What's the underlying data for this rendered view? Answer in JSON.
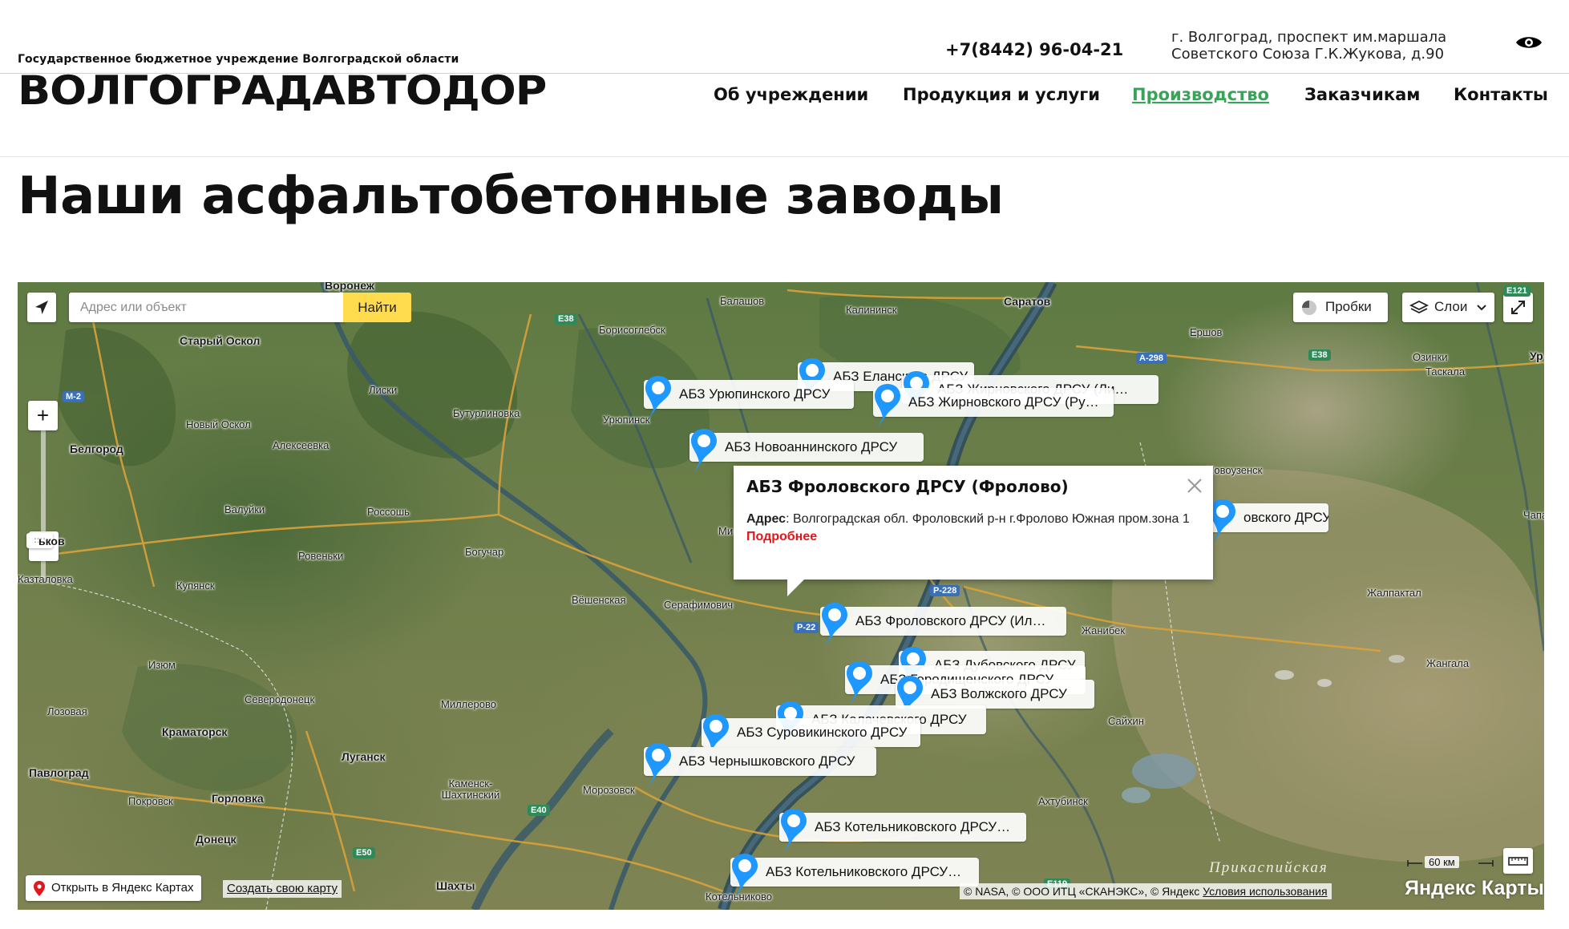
{
  "header": {
    "org_line": "Государственное бюджетное учреждение Волгоградской области",
    "brand": "ВОЛГОГРАДАВТОДОР",
    "phone": "+7(8442) 96-04-21",
    "address_line1": "г. Волгоград, проспект им.маршала",
    "address_line2": "Советского Союза Г.К.Жукова, д.90",
    "nav": [
      {
        "label": "Об учреждении"
      },
      {
        "label": "Продукция и услуги"
      },
      {
        "label": "Производство",
        "active": true
      },
      {
        "label": "Заказчикам"
      },
      {
        "label": "Контакты"
      }
    ],
    "accent_color": "#3aa35a"
  },
  "page": {
    "title": "Наши асфальтобетонные заводы"
  },
  "map": {
    "search": {
      "placeholder": "Адрес или объект",
      "button": "Найти"
    },
    "traffic_label": "Пробки",
    "layers_label": "Слои",
    "zoom_in": "+",
    "zoom_out": "−",
    "cities": [
      "Воронеж",
      "Балашов",
      "Калининск",
      "Саратов",
      "Борисоглебск",
      "Старый Оскол",
      "Ершов",
      "Озинки",
      "Таскала",
      "Ур",
      "Урюпинск",
      "Лиски",
      "Бутурлиновка",
      "Новый Оскол",
      "Алексеевка",
      "Белгород",
      "Валуйки",
      "Россошь",
      "Новоузенск",
      "Чапае",
      "ьков",
      "Ровеньки",
      "Богучар",
      "Купянск",
      "Вёшенская",
      "Серафимович",
      "Казталовка",
      "Жалпактал",
      "Жанибек",
      "Изюм",
      "Жангала",
      "Северодонецк",
      "Лозовая",
      "Миллерово",
      "Сайхин",
      "Краматорск",
      "Луганск",
      "Павлоград",
      "Каменск-Шахтинский",
      "Морозовск",
      "Ахтубинск",
      "Покровск",
      "Горловка",
      "Донецк",
      "Шахты",
      "Котельниково",
      "Ми"
    ],
    "roads": [
      "E38",
      "M-2",
      "A-298",
      "E38",
      "E121",
      "P-228",
      "P-22",
      "E40",
      "E50",
      "E119"
    ],
    "markers": [
      {
        "label": "АБЗ Еланского ДРСУ"
      },
      {
        "label": "АБЗ Урюпинского ДРСУ"
      },
      {
        "label": "АБЗ Жирновского ДРСУ (Ли…"
      },
      {
        "label": "АБЗ Жирновского ДРСУ (Ру…"
      },
      {
        "label": "АБЗ Новоаннинского ДРСУ"
      },
      {
        "label": "овского ДРСУ"
      },
      {
        "label": "АБЗ Фроловского ДРСУ (Ил…"
      },
      {
        "label": "АБЗ Дубовского ДРСУ"
      },
      {
        "label": "АБЗ Городищенского ДРСУ"
      },
      {
        "label": "АБЗ Волжского ДРСУ"
      },
      {
        "label": "АБЗ Калачевского ДРСУ"
      },
      {
        "label": "АБЗ Суровикинского ДРСУ"
      },
      {
        "label": "АБЗ Чернышковского ДРСУ"
      },
      {
        "label": "АБЗ Котельниковского ДРСУ…"
      },
      {
        "label": "АБЗ Котельниковского ДРСУ…"
      }
    ],
    "balloon": {
      "title": "АБЗ Фроловского ДРСУ (Фролово)",
      "address_label": "Адрес",
      "address": ": Волгоградская обл. Фроловский р-н г.Фролово Южная пром.зона 1",
      "more": "Подробнее"
    },
    "open_yandex": "Открыть в Яндекс Картах",
    "create_map": "Создать свою карту",
    "copyright": "© NASA, © ООО ИТЦ «СКАНЭКС», © Яндекс",
    "terms": "Условия использования",
    "scale": "60 км",
    "region": "Прикаспийская",
    "logo": "Яндекс Карты",
    "marker_color": "#1e98ff"
  }
}
